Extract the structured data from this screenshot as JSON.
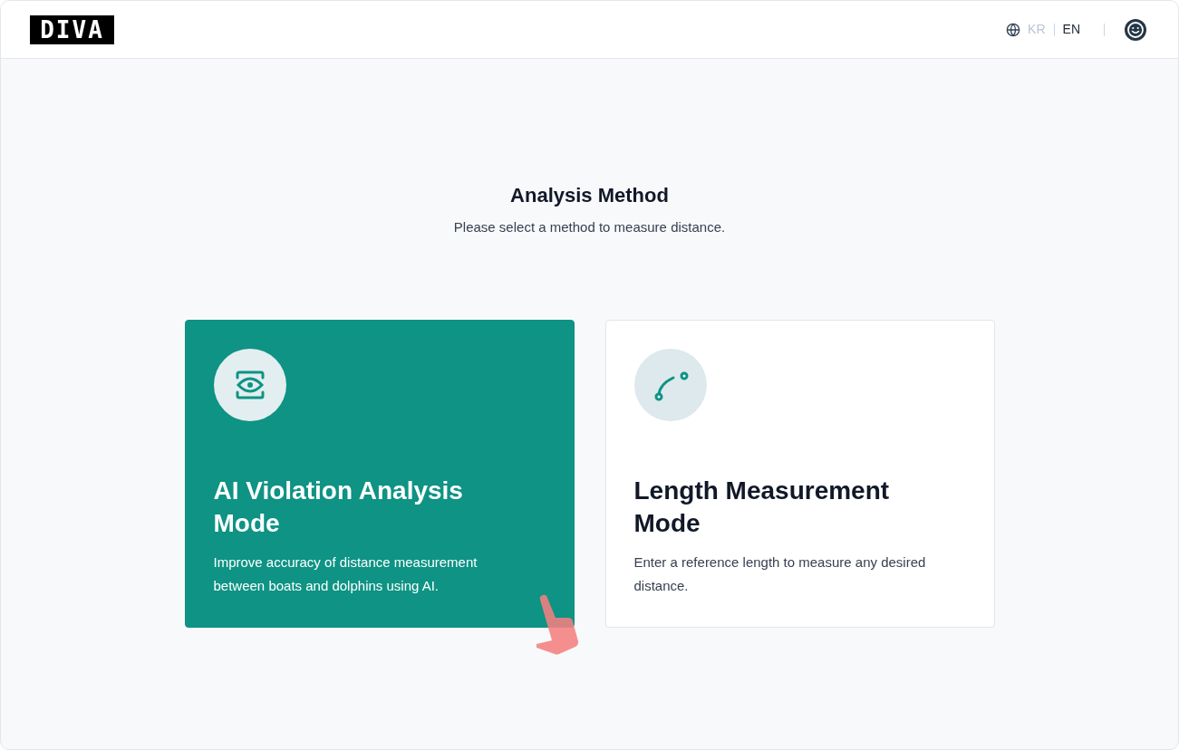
{
  "header": {
    "logo": "DIVA",
    "languages": [
      {
        "label": "KR",
        "selected": false
      },
      {
        "label": "EN",
        "selected": true
      }
    ]
  },
  "heading": {
    "title": "Analysis Method",
    "subtitle": "Please select a method to measure distance."
  },
  "cards": [
    {
      "kind": "ai",
      "title": "AI Violation Analysis Mode",
      "description": "Improve accuracy of distance measurement between boats and dolphins using AI.",
      "selected": true
    },
    {
      "kind": "length",
      "title": "Length Measurement Mode",
      "description": "Enter a reference length to measure any desired distance.",
      "selected": false
    }
  ]
}
